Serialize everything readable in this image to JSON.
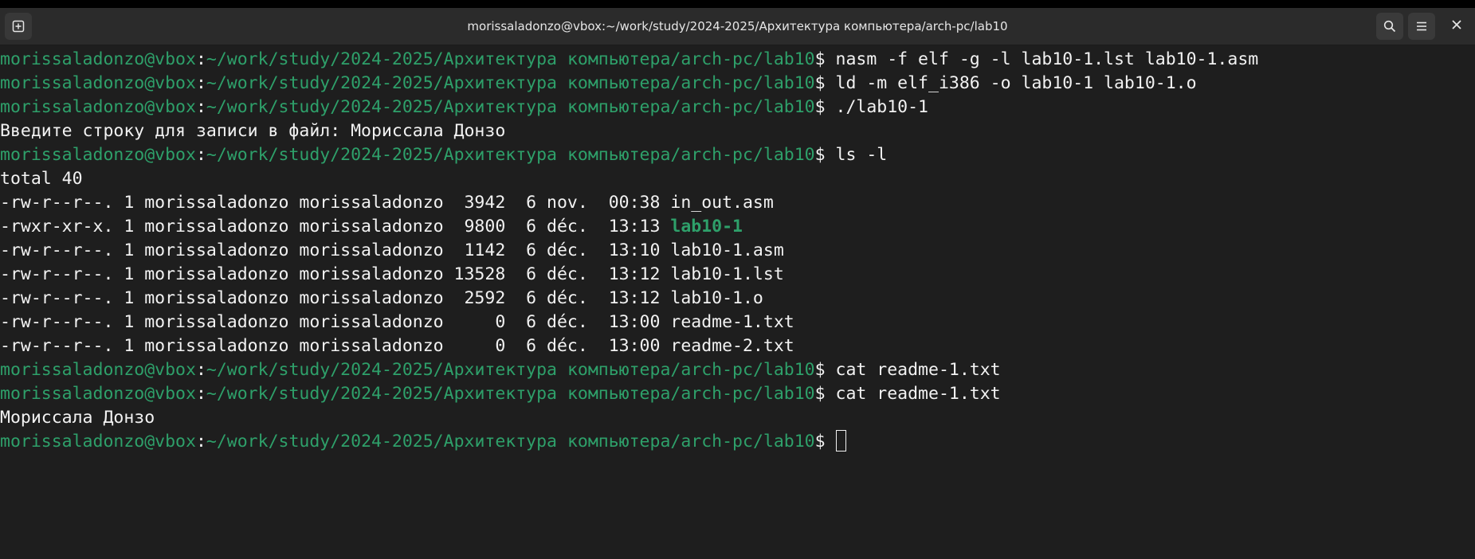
{
  "window": {
    "title": "morissaladonzo@vbox:~/work/study/2024-2025/Архитектура компьютера/arch-pc/lab10"
  },
  "prompt": {
    "user_host": "morissaladonzo@vbox",
    "colon": ":",
    "path": "~/work/study/2024-2025/Архитектура компьютера/arch-pc/lab10",
    "symbol": "$ "
  },
  "lines": [
    {
      "type": "prompt",
      "command": "nasm -f elf -g -l lab10-1.lst lab10-1.asm"
    },
    {
      "type": "prompt",
      "command": "ld -m elf_i386 -o lab10-1 lab10-1.o"
    },
    {
      "type": "prompt",
      "command": "./lab10-1"
    },
    {
      "type": "output",
      "text": "Введите строку для записи в файл: Мориссала Донзо"
    },
    {
      "type": "prompt",
      "command": "ls -l"
    },
    {
      "type": "output",
      "text": "total 40"
    },
    {
      "type": "ls",
      "meta": "-rw-r--r--. 1 morissaladonzo morissaladonzo  3942  6 nov.  00:38 ",
      "name": "in_out.asm",
      "exec": false
    },
    {
      "type": "ls",
      "meta": "-rwxr-xr-x. 1 morissaladonzo morissaladonzo  9800  6 déc.  13:13 ",
      "name": "lab10-1",
      "exec": true
    },
    {
      "type": "ls",
      "meta": "-rw-r--r--. 1 morissaladonzo morissaladonzo  1142  6 déc.  13:10 ",
      "name": "lab10-1.asm",
      "exec": false
    },
    {
      "type": "ls",
      "meta": "-rw-r--r--. 1 morissaladonzo morissaladonzo 13528  6 déc.  13:12 ",
      "name": "lab10-1.lst",
      "exec": false
    },
    {
      "type": "ls",
      "meta": "-rw-r--r--. 1 morissaladonzo morissaladonzo  2592  6 déc.  13:12 ",
      "name": "lab10-1.o",
      "exec": false
    },
    {
      "type": "ls",
      "meta": "-rw-r--r--. 1 morissaladonzo morissaladonzo     0  6 déc.  13:00 ",
      "name": "readme-1.txt",
      "exec": false
    },
    {
      "type": "ls",
      "meta": "-rw-r--r--. 1 morissaladonzo morissaladonzo     0  6 déc.  13:00 ",
      "name": "readme-2.txt",
      "exec": false
    },
    {
      "type": "prompt",
      "command": "cat readme-1.txt"
    },
    {
      "type": "prompt",
      "command": "cat readme-1.txt"
    },
    {
      "type": "output",
      "text": "Мориссала Донзо"
    },
    {
      "type": "prompt",
      "command": "",
      "cursor": true
    }
  ],
  "icons": {
    "new_tab": "new-tab-icon",
    "search": "search-icon",
    "menu": "hamburger-menu-icon",
    "close": "close-icon"
  },
  "colors": {
    "background": "#1e1e1e",
    "titlebar": "#2b2b2b",
    "prompt_green": "#2ea06a",
    "text": "#f2f2f2"
  }
}
